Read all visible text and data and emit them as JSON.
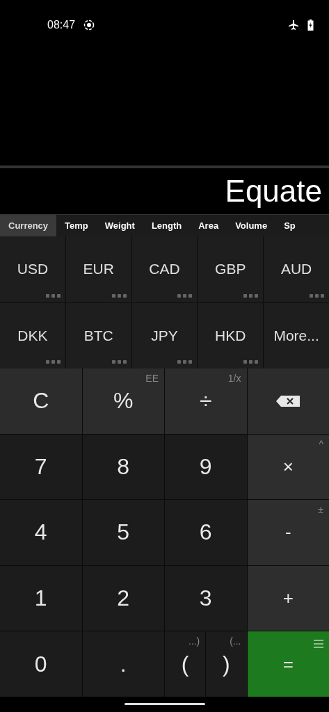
{
  "status_bar": {
    "time": "08:47"
  },
  "display": {
    "title": "Equate"
  },
  "tabs": [
    {
      "label": "Currency",
      "selected": true
    },
    {
      "label": "Temp",
      "selected": false
    },
    {
      "label": "Weight",
      "selected": false
    },
    {
      "label": "Length",
      "selected": false
    },
    {
      "label": "Area",
      "selected": false
    },
    {
      "label": "Volume",
      "selected": false
    },
    {
      "label": "Sp",
      "selected": false
    }
  ],
  "unit_keys": [
    {
      "label": "USD",
      "has_menu": true
    },
    {
      "label": "EUR",
      "has_menu": true
    },
    {
      "label": "CAD",
      "has_menu": true
    },
    {
      "label": "GBP",
      "has_menu": true
    },
    {
      "label": "AUD",
      "has_menu": true
    },
    {
      "label": "DKK",
      "has_menu": true
    },
    {
      "label": "BTC",
      "has_menu": true
    },
    {
      "label": "JPY",
      "has_menu": true
    },
    {
      "label": "HKD",
      "has_menu": true
    },
    {
      "label": "More...",
      "has_menu": false
    }
  ],
  "keypad": [
    {
      "kind": "function",
      "label": "C"
    },
    {
      "kind": "function",
      "label": "%",
      "hint": "EE"
    },
    {
      "kind": "function",
      "label": "÷",
      "hint": "1/x"
    },
    {
      "kind": "backspace"
    },
    {
      "kind": "digit",
      "label": "7"
    },
    {
      "kind": "digit",
      "label": "8"
    },
    {
      "kind": "digit",
      "label": "9"
    },
    {
      "kind": "operator",
      "label": "×",
      "hint": "^"
    },
    {
      "kind": "digit",
      "label": "4"
    },
    {
      "kind": "digit",
      "label": "5"
    },
    {
      "kind": "digit",
      "label": "6"
    },
    {
      "kind": "operator",
      "label": "-",
      "hint": "±"
    },
    {
      "kind": "digit",
      "label": "1"
    },
    {
      "kind": "digit",
      "label": "2"
    },
    {
      "kind": "digit",
      "label": "3"
    },
    {
      "kind": "operator",
      "label": "+"
    },
    {
      "kind": "digit",
      "label": "0"
    },
    {
      "kind": "digit",
      "label": "."
    },
    {
      "kind": "paren",
      "label": "(",
      "hint": "...)"
    },
    {
      "kind": "paren",
      "label": ")",
      "hint": "(..."
    },
    {
      "kind": "equals",
      "label": "="
    }
  ]
}
